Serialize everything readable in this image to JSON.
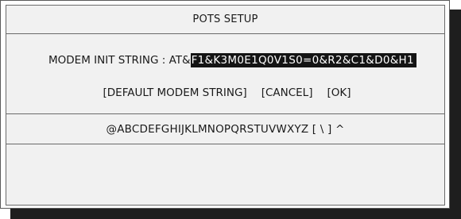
{
  "dialog": {
    "title": "POTS SETUP"
  },
  "init": {
    "label": "MODEM INIT STRING : AT&",
    "value": "F1&K3M0E1Q0V1S0=0&R2&C1&D0&H1"
  },
  "buttons": {
    "default_label": "[DEFAULT MODEM STRING]",
    "cancel_label": "[CANCEL]",
    "ok_label": "[OK]"
  },
  "charset": {
    "text": "@ABCDEFGHIJKLMNOPQRSTUVWXYZ [ \\ ] ^"
  },
  "colors": {
    "background": "#f1f1f1",
    "highlight": "#141414",
    "shadow": "#1e1e1e"
  }
}
